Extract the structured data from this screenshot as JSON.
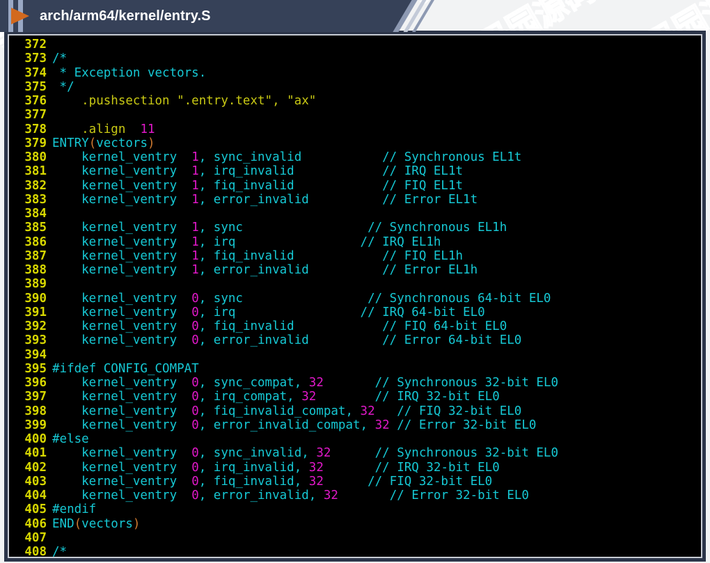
{
  "window": {
    "title": "arch/arm64/kernel/entry.S",
    "play_icon": "play-triangle-icon",
    "accent_color": "#d2691e",
    "titlebar_color": "#364158"
  },
  "watermark": {
    "text": "源码园",
    "color": "#ffffff"
  },
  "editor": {
    "background": "#000000",
    "linenumber_color": "#d7d700",
    "first_line": 372,
    "last_line": 408,
    "colors": {
      "identifier": "#16c8d4",
      "number": "#e018c8",
      "directive": "#c8c814",
      "comment": "#16c8d4",
      "paren": "#d07a30"
    },
    "lines": [
      {
        "n": "372",
        "tokens": []
      },
      {
        "n": "373",
        "tokens": [
          {
            "t": "/*",
            "c": "c-cmt"
          }
        ]
      },
      {
        "n": "374",
        "tokens": [
          {
            "t": " * Exception vectors.",
            "c": "c-cmt"
          }
        ]
      },
      {
        "n": "375",
        "tokens": [
          {
            "t": " */",
            "c": "c-cmt"
          }
        ]
      },
      {
        "n": "376",
        "tokens": [
          {
            "t": "    .pushsection \".entry.text\", \"ax\"",
            "c": "c-yel"
          }
        ]
      },
      {
        "n": "377",
        "tokens": []
      },
      {
        "n": "378",
        "tokens": [
          {
            "t": "    .align  ",
            "c": "c-yel"
          },
          {
            "t": "11",
            "c": "c-mag"
          }
        ]
      },
      {
        "n": "379",
        "tokens": [
          {
            "t": "ENTRY",
            "c": "c-cyan"
          },
          {
            "t": "(",
            "c": "c-orange"
          },
          {
            "t": "vectors",
            "c": "c-cyan"
          },
          {
            "t": ")",
            "c": "c-orange"
          }
        ]
      },
      {
        "n": "380",
        "tokens": [
          {
            "t": "    kernel_ventry  ",
            "c": "c-cyan"
          },
          {
            "t": "1",
            "c": "c-mag"
          },
          {
            "t": ", sync_invalid           ",
            "c": "c-cyan"
          },
          {
            "t": "// Synchronous EL1t",
            "c": "c-cmt"
          }
        ]
      },
      {
        "n": "381",
        "tokens": [
          {
            "t": "    kernel_ventry  ",
            "c": "c-cyan"
          },
          {
            "t": "1",
            "c": "c-mag"
          },
          {
            "t": ", irq_invalid            ",
            "c": "c-cyan"
          },
          {
            "t": "// IRQ EL1t",
            "c": "c-cmt"
          }
        ]
      },
      {
        "n": "382",
        "tokens": [
          {
            "t": "    kernel_ventry  ",
            "c": "c-cyan"
          },
          {
            "t": "1",
            "c": "c-mag"
          },
          {
            "t": ", fiq_invalid            ",
            "c": "c-cyan"
          },
          {
            "t": "// FIQ EL1t",
            "c": "c-cmt"
          }
        ]
      },
      {
        "n": "383",
        "tokens": [
          {
            "t": "    kernel_ventry  ",
            "c": "c-cyan"
          },
          {
            "t": "1",
            "c": "c-mag"
          },
          {
            "t": ", error_invalid          ",
            "c": "c-cyan"
          },
          {
            "t": "// Error EL1t",
            "c": "c-cmt"
          }
        ]
      },
      {
        "n": "384",
        "tokens": []
      },
      {
        "n": "385",
        "tokens": [
          {
            "t": "    kernel_ventry  ",
            "c": "c-cyan"
          },
          {
            "t": "1",
            "c": "c-mag"
          },
          {
            "t": ", sync                 ",
            "c": "c-cyan"
          },
          {
            "t": "// Synchronous EL1h",
            "c": "c-cmt"
          }
        ]
      },
      {
        "n": "386",
        "tokens": [
          {
            "t": "    kernel_ventry  ",
            "c": "c-cyan"
          },
          {
            "t": "1",
            "c": "c-mag"
          },
          {
            "t": ", irq                 ",
            "c": "c-cyan"
          },
          {
            "t": "// IRQ EL1h",
            "c": "c-cmt"
          }
        ]
      },
      {
        "n": "387",
        "tokens": [
          {
            "t": "    kernel_ventry  ",
            "c": "c-cyan"
          },
          {
            "t": "1",
            "c": "c-mag"
          },
          {
            "t": ", fiq_invalid            ",
            "c": "c-cyan"
          },
          {
            "t": "// FIQ EL1h",
            "c": "c-cmt"
          }
        ]
      },
      {
        "n": "388",
        "tokens": [
          {
            "t": "    kernel_ventry  ",
            "c": "c-cyan"
          },
          {
            "t": "1",
            "c": "c-mag"
          },
          {
            "t": ", error_invalid          ",
            "c": "c-cyan"
          },
          {
            "t": "// Error EL1h",
            "c": "c-cmt"
          }
        ]
      },
      {
        "n": "389",
        "tokens": []
      },
      {
        "n": "390",
        "tokens": [
          {
            "t": "    kernel_ventry  ",
            "c": "c-cyan"
          },
          {
            "t": "0",
            "c": "c-mag"
          },
          {
            "t": ", sync                 ",
            "c": "c-cyan"
          },
          {
            "t": "// Synchronous 64-bit EL0",
            "c": "c-cmt"
          }
        ]
      },
      {
        "n": "391",
        "tokens": [
          {
            "t": "    kernel_ventry  ",
            "c": "c-cyan"
          },
          {
            "t": "0",
            "c": "c-mag"
          },
          {
            "t": ", irq                 ",
            "c": "c-cyan"
          },
          {
            "t": "// IRQ 64-bit EL0",
            "c": "c-cmt"
          }
        ]
      },
      {
        "n": "392",
        "tokens": [
          {
            "t": "    kernel_ventry  ",
            "c": "c-cyan"
          },
          {
            "t": "0",
            "c": "c-mag"
          },
          {
            "t": ", fiq_invalid            ",
            "c": "c-cyan"
          },
          {
            "t": "// FIQ 64-bit EL0",
            "c": "c-cmt"
          }
        ]
      },
      {
        "n": "393",
        "tokens": [
          {
            "t": "    kernel_ventry  ",
            "c": "c-cyan"
          },
          {
            "t": "0",
            "c": "c-mag"
          },
          {
            "t": ", error_invalid          ",
            "c": "c-cyan"
          },
          {
            "t": "// Error 64-bit EL0",
            "c": "c-cmt"
          }
        ]
      },
      {
        "n": "394",
        "tokens": []
      },
      {
        "n": "395",
        "tokens": [
          {
            "t": "#ifdef CONFIG_COMPAT",
            "c": "c-cyan"
          }
        ]
      },
      {
        "n": "396",
        "tokens": [
          {
            "t": "    kernel_ventry  ",
            "c": "c-cyan"
          },
          {
            "t": "0",
            "c": "c-mag"
          },
          {
            "t": ", sync_compat, ",
            "c": "c-cyan"
          },
          {
            "t": "32",
            "c": "c-mag"
          },
          {
            "t": "       ",
            "c": "c-cyan"
          },
          {
            "t": "// Synchronous 32-bit EL0",
            "c": "c-cmt"
          }
        ]
      },
      {
        "n": "397",
        "tokens": [
          {
            "t": "    kernel_ventry  ",
            "c": "c-cyan"
          },
          {
            "t": "0",
            "c": "c-mag"
          },
          {
            "t": ", irq_compat, ",
            "c": "c-cyan"
          },
          {
            "t": "32",
            "c": "c-mag"
          },
          {
            "t": "        ",
            "c": "c-cyan"
          },
          {
            "t": "// IRQ 32-bit EL0",
            "c": "c-cmt"
          }
        ]
      },
      {
        "n": "398",
        "tokens": [
          {
            "t": "    kernel_ventry  ",
            "c": "c-cyan"
          },
          {
            "t": "0",
            "c": "c-mag"
          },
          {
            "t": ", fiq_invalid_compat, ",
            "c": "c-cyan"
          },
          {
            "t": "32",
            "c": "c-mag"
          },
          {
            "t": "   ",
            "c": "c-cyan"
          },
          {
            "t": "// FIQ 32-bit EL0",
            "c": "c-cmt"
          }
        ]
      },
      {
        "n": "399",
        "tokens": [
          {
            "t": "    kernel_ventry  ",
            "c": "c-cyan"
          },
          {
            "t": "0",
            "c": "c-mag"
          },
          {
            "t": ", error_invalid_compat, ",
            "c": "c-cyan"
          },
          {
            "t": "32",
            "c": "c-mag"
          },
          {
            "t": " ",
            "c": "c-cyan"
          },
          {
            "t": "// Error 32-bit EL0",
            "c": "c-cmt"
          }
        ]
      },
      {
        "n": "400",
        "tokens": [
          {
            "t": "#else",
            "c": "c-cyan"
          }
        ]
      },
      {
        "n": "401",
        "tokens": [
          {
            "t": "    kernel_ventry  ",
            "c": "c-cyan"
          },
          {
            "t": "0",
            "c": "c-mag"
          },
          {
            "t": ", sync_invalid, ",
            "c": "c-cyan"
          },
          {
            "t": "32",
            "c": "c-mag"
          },
          {
            "t": "      ",
            "c": "c-cyan"
          },
          {
            "t": "// Synchronous 32-bit EL0",
            "c": "c-cmt"
          }
        ]
      },
      {
        "n": "402",
        "tokens": [
          {
            "t": "    kernel_ventry  ",
            "c": "c-cyan"
          },
          {
            "t": "0",
            "c": "c-mag"
          },
          {
            "t": ", irq_invalid, ",
            "c": "c-cyan"
          },
          {
            "t": "32",
            "c": "c-mag"
          },
          {
            "t": "       ",
            "c": "c-cyan"
          },
          {
            "t": "// IRQ 32-bit EL0",
            "c": "c-cmt"
          }
        ]
      },
      {
        "n": "403",
        "tokens": [
          {
            "t": "    kernel_ventry  ",
            "c": "c-cyan"
          },
          {
            "t": "0",
            "c": "c-mag"
          },
          {
            "t": ", fiq_invalid, ",
            "c": "c-cyan"
          },
          {
            "t": "32",
            "c": "c-mag"
          },
          {
            "t": "      ",
            "c": "c-cyan"
          },
          {
            "t": "// FIQ 32-bit EL0",
            "c": "c-cmt"
          }
        ]
      },
      {
        "n": "404",
        "tokens": [
          {
            "t": "    kernel_ventry  ",
            "c": "c-cyan"
          },
          {
            "t": "0",
            "c": "c-mag"
          },
          {
            "t": ", error_invalid, ",
            "c": "c-cyan"
          },
          {
            "t": "32",
            "c": "c-mag"
          },
          {
            "t": "       ",
            "c": "c-cyan"
          },
          {
            "t": "// Error 32-bit EL0",
            "c": "c-cmt"
          }
        ]
      },
      {
        "n": "405",
        "tokens": [
          {
            "t": "#endif",
            "c": "c-cyan"
          }
        ]
      },
      {
        "n": "406",
        "tokens": [
          {
            "t": "END",
            "c": "c-cyan"
          },
          {
            "t": "(",
            "c": "c-orange"
          },
          {
            "t": "vectors",
            "c": "c-cyan"
          },
          {
            "t": ")",
            "c": "c-orange"
          }
        ]
      },
      {
        "n": "407",
        "tokens": []
      },
      {
        "n": "408",
        "tokens": [
          {
            "t": "/*",
            "c": "c-cmt"
          }
        ]
      }
    ]
  }
}
